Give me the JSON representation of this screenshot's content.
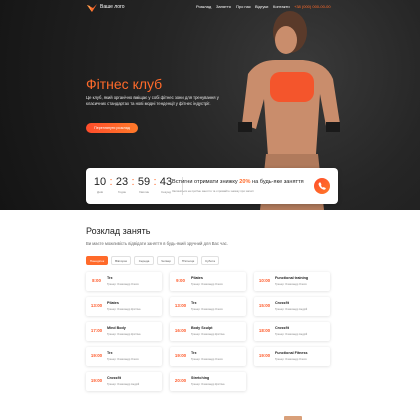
{
  "header": {
    "logo_text": "Ваше лого",
    "nav": [
      "Розклад",
      "Заняття",
      "Про нас",
      "Відгуки",
      "Контакти"
    ],
    "phone": "+38 (000) 000-00-00"
  },
  "hero": {
    "title": "Фітнес клуб",
    "text": "Це клуб, який органічно вміщає у собі фітнес зони для тренування у класичних стандартах та нові модні тенденції у фітнес індустрії.",
    "button_label": "Переглянути розклад"
  },
  "promo": {
    "timer": {
      "days": "10",
      "hours": "23",
      "minutes": "59",
      "seconds": "43",
      "days_label": "Днів",
      "hours_label": "Годин",
      "minutes_label": "Хвилин",
      "seconds_label": "Секунд"
    },
    "title_before": "Встигни отримати знижку",
    "title_accent": "20%",
    "title_after": "на будь-яке заняття",
    "subtitle": "Залишіться на пробне заняття та отримайте знижку при записі",
    "call_icon": "phone-icon"
  },
  "schedule": {
    "title": "Розклад занять",
    "subtitle": "Ви маєте можливість відвідати заняття в будь-який зручний для Вас час.",
    "tabs": [
      "Понеділок",
      "Вівторок",
      "Середа",
      "Четвер",
      "П'ятниця",
      "Субота"
    ],
    "active_tab": 0,
    "cards": [
      {
        "time": "8:00",
        "name": "Trx",
        "coach": "Тренер: Олександр Олеся"
      },
      {
        "time": "9:00",
        "name": "Pilates",
        "coach": "Тренер: Олександр Олеся"
      },
      {
        "time": "10:00",
        "name": "Functional training",
        "coach": "Тренер: Олександр Олеся"
      },
      {
        "time": "13:00",
        "name": "Pilates",
        "coach": "Тренер: Олександр Крістіна"
      },
      {
        "time": "13:00",
        "name": "Trx",
        "coach": "Тренер: Олександр Олеся"
      },
      {
        "time": "15:00",
        "name": "Crossfit",
        "coach": "Тренер: Олександр Андрій"
      },
      {
        "time": "17:00",
        "name": "Mind Body",
        "coach": "Тренер: Олександр Крістіна"
      },
      {
        "time": "16:00",
        "name": "Body Sculpt",
        "coach": "Тренер: Олександр Крістіна"
      },
      {
        "time": "18:00",
        "name": "Crossfit",
        "coach": "Тренер: Олександр Андрій"
      },
      {
        "time": "19:00",
        "name": "Trx",
        "coach": "Тренер: Олександр Олеся"
      },
      {
        "time": "19:00",
        "name": "Trx",
        "coach": "Тренер: Олександр Олеся"
      },
      {
        "time": "19:00",
        "name": "Functional Fitness",
        "coach": "Тренер: Олександр Олеся"
      },
      {
        "time": "19:00",
        "name": "Crossfit",
        "coach": "Тренер: Олександр Андрій"
      },
      {
        "time": "20:00",
        "name": "Stretching",
        "coach": "Тренер: Олександр Крістіна"
      }
    ]
  },
  "colors": {
    "accent": "#ff6a2a",
    "hero_bg": "#1a1a1a",
    "text_dark": "#222222"
  }
}
